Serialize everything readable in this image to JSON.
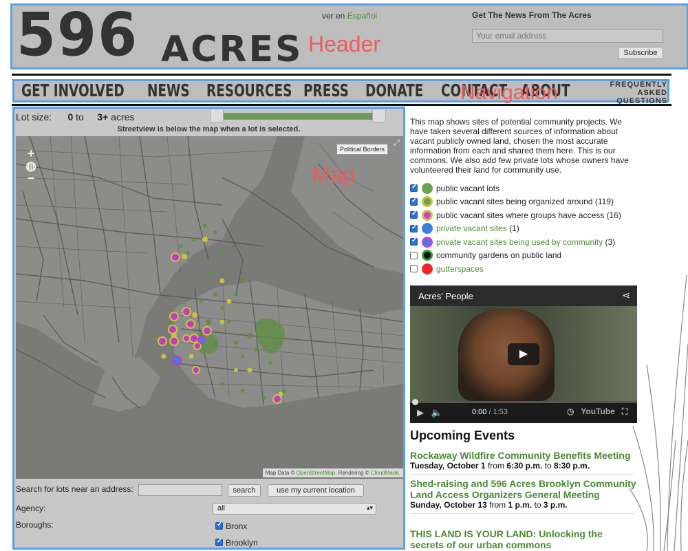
{
  "header": {
    "logo_number": "596",
    "logo_word": "ACRES",
    "lang_prefix": "ver en",
    "lang_link": "Español",
    "news_title": "Get The News From The Acres",
    "email_placeholder": "Your email address",
    "subscribe_label": "Subscribe",
    "overlay_label": "Header"
  },
  "nav": {
    "items": [
      "GET INVOLVED",
      "NEWS",
      "RESOURCES",
      "PRESS",
      "DONATE",
      "CONTACT",
      "ABOUT"
    ],
    "faq_line1": "FREQUENTLY",
    "faq_line2": "ASKED QUESTIONS",
    "overlay_label": "Navigation"
  },
  "map_panel": {
    "lot_size_label": "Lot size:",
    "lot_min": "0",
    "lot_to": "to",
    "lot_max": "3+",
    "lot_unit": "acres",
    "streetview_note": "Streetview is below the map when a lot is selected.",
    "political_borders": "Political Borders",
    "overlay_label": "Map",
    "attribution_prefix": "Map Data ©",
    "attribution_osm": "OpenStreetMap",
    "attribution_mid": ". Rendering ©",
    "attribution_cm": "CloudMade",
    "search_label": "Search for lots near an address:",
    "search_button": "search",
    "location_button": "use my current location",
    "agency_label": "Agency:",
    "agency_value": "all",
    "boroughs_label": "Boroughs:",
    "boroughs": [
      {
        "name": "Bronx",
        "checked": true
      },
      {
        "name": "Brooklyn",
        "checked": true
      }
    ]
  },
  "intro_text": "This map shows sites of potential community projects. We have taken several different sources of information about vacant publicly owned land, chosen the most accurate information from each and shared them here. This is our commons. We also add few private lots whose owners have volunteered their land for community use.",
  "legend": [
    {
      "label": "public vacant lots",
      "count": "",
      "checked": true,
      "link": false,
      "color": "#6aa352",
      "ring": "#6aa352"
    },
    {
      "label": "public vacant sites being organized around",
      "count": "(119)",
      "checked": true,
      "link": false,
      "color": "#6aa352",
      "ring": "#c8c43a"
    },
    {
      "label": "public vacant sites where groups have access",
      "count": "(16)",
      "checked": true,
      "link": false,
      "color": "#d23cd6",
      "ring": "#c8c43a"
    },
    {
      "label": "private vacant sites",
      "count": "(1)",
      "checked": true,
      "link": true,
      "color": "#3a82e0",
      "ring": "#3a82e0"
    },
    {
      "label": "private vacant sites being used by community",
      "count": "(3)",
      "checked": true,
      "link": true,
      "color": "#3a82e0",
      "ring": "#d23cd6"
    },
    {
      "label": "community gardens on public land",
      "count": "",
      "checked": false,
      "link": false,
      "color": "#111111",
      "ring": "#2f9a2f"
    },
    {
      "label": "gutterspaces",
      "count": "",
      "checked": false,
      "link": true,
      "color": "#f02828",
      "ring": "#f02828"
    }
  ],
  "video": {
    "title": "Acres' People",
    "time_current": "0:00",
    "time_total": "1:53",
    "brand": "YouTube"
  },
  "events": {
    "heading": "Upcoming Events",
    "items": [
      {
        "title": "Rockaway Wildfire Community Benefits Meeting",
        "date": "Tuesday, October 1",
        "from_word": "from",
        "start": "6:30 p.m.",
        "to_word": "to",
        "end": "8:30 p.m."
      },
      {
        "title": "Shed-raising and 596 Acres Brooklyn Community Land Access Organizers General Meeting",
        "date": "Sunday, October 13",
        "from_word": "from",
        "start": "1 p.m.",
        "to_word": "to",
        "end": "3 p.m."
      },
      {
        "title": "THIS LAND IS YOUR LAND: Unlocking the secrets of our urban commons",
        "date": "",
        "from_word": "",
        "start": "",
        "to_word": "",
        "end": ""
      }
    ]
  }
}
